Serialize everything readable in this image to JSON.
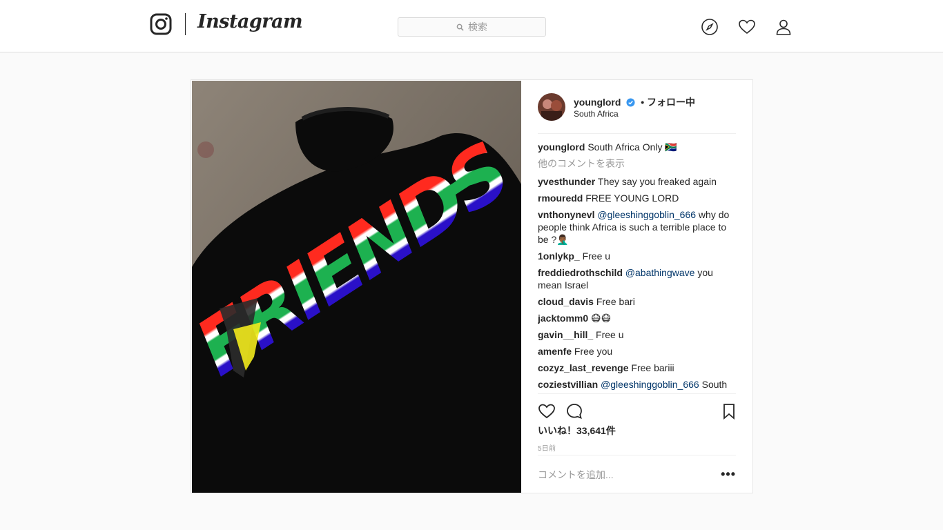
{
  "nav": {
    "wordmark": "Instagram",
    "search_placeholder": "検索"
  },
  "post": {
    "username": "younglord",
    "follow_state": "• フォロー中",
    "location": "South Africa",
    "photo_text": "FRIENDS",
    "caption": {
      "user": "younglord",
      "text": "South Africa Only 🇿🇦"
    },
    "more_comments_label": "他のコメントを表示",
    "comments": [
      {
        "user": "yvesthunder",
        "mention": "",
        "text": "They say you freaked again"
      },
      {
        "user": "rmouredd",
        "mention": "",
        "text": "FREE YOUNG LORD"
      },
      {
        "user": "vnthonynevl",
        "mention": "@gleeshinggoblin_666",
        "text": "why do people think Africa is such a terrible place to be ?🤦🏾‍♂️"
      },
      {
        "user": "1onlykp_",
        "mention": "",
        "text": "Free u"
      },
      {
        "user": "freddiedrothschild",
        "mention": "@abathingwave",
        "text": "you mean Israel"
      },
      {
        "user": "cloud_davis",
        "mention": "",
        "text": "Free bari"
      },
      {
        "user": "jacktomm0",
        "mention": "",
        "text": "😷😷"
      },
      {
        "user": "gavin__hill_",
        "mention": "",
        "text": "Free u"
      },
      {
        "user": "amenfe",
        "mention": "",
        "text": "Free you"
      },
      {
        "user": "cozyz_last_revenge",
        "mention": "",
        "text": "Free bariii"
      },
      {
        "user": "coziestvillian",
        "mention": "@gleeshinggoblin_666",
        "text": "South"
      }
    ],
    "likes": "いいね！33,641件",
    "time_ago": "5日前",
    "add_comment_placeholder": "コメントを追加...",
    "more_options": "•••"
  },
  "colors": {
    "verified": "#3897f0",
    "mention": "#003569",
    "muted": "#999999",
    "border": "#dbdbdb"
  },
  "icons": [
    "instagram-camera-icon",
    "search-icon",
    "compass-icon",
    "heart-icon",
    "profile-icon",
    "verified-badge-icon",
    "like-icon",
    "comment-icon",
    "bookmark-icon"
  ]
}
